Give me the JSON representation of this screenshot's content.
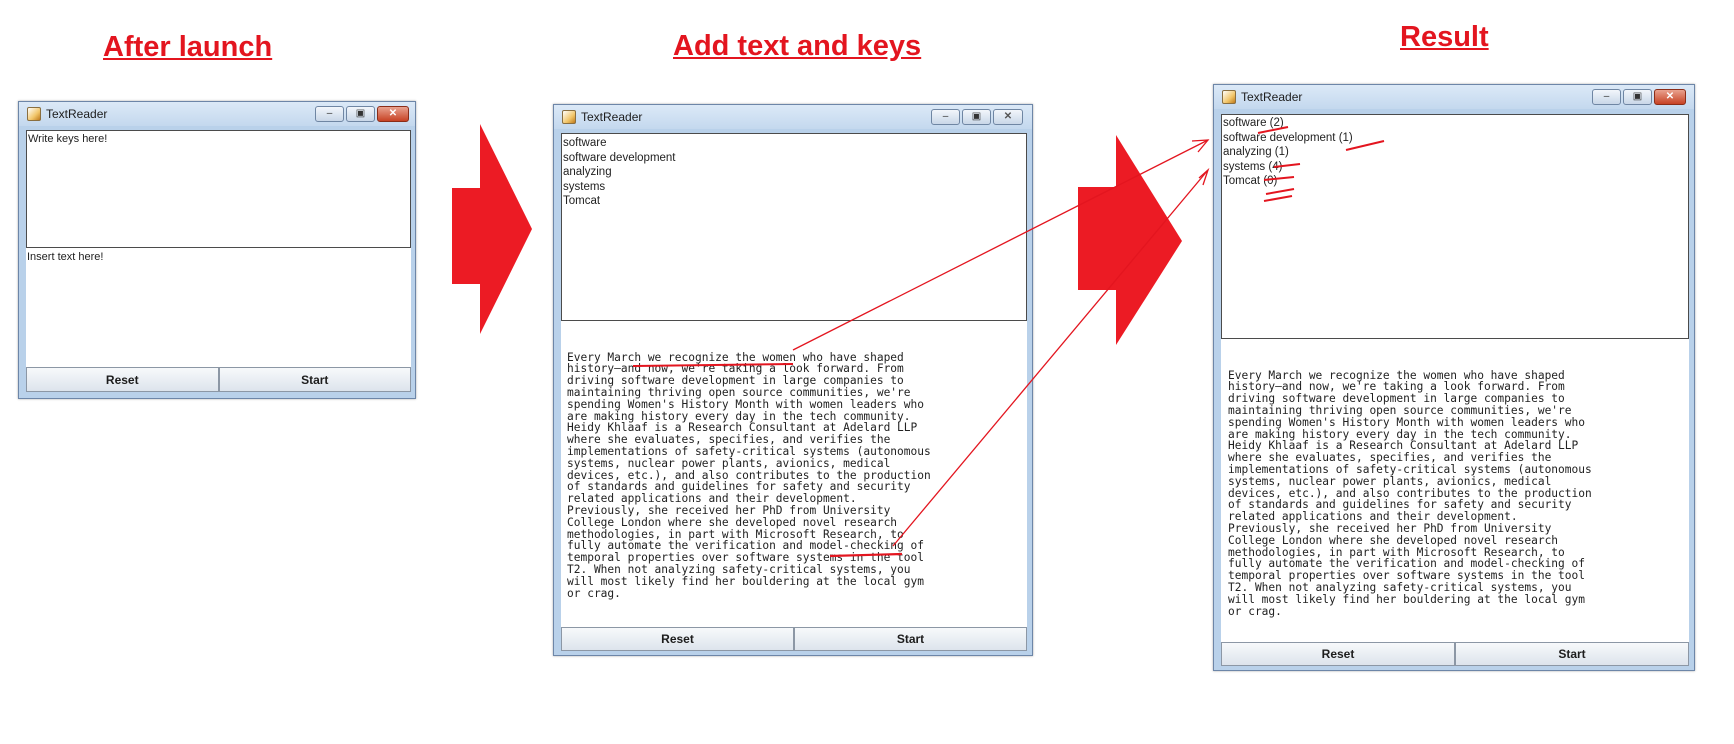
{
  "headings": {
    "step1": "After launch",
    "step2": "Add text and keys",
    "step3": "Result"
  },
  "window": {
    "title": "TextReader",
    "minimize_glyph": "‒",
    "maximize_glyph": "▣",
    "close_glyph": "✕"
  },
  "step1": {
    "keys_placeholder": "Write keys here!",
    "text_placeholder": "Insert text here!",
    "reset_label": "Reset",
    "start_label": "Start"
  },
  "step2": {
    "keys": [
      "software",
      "software development",
      "analyzing",
      "systems",
      "Tomcat"
    ],
    "text": "Every March we recognize the women who have shaped\nhistory—and now, we're taking a look forward. From\ndriving software development in large companies to\nmaintaining thriving open source communities, we're\nspending Women's History Month with women leaders who\nare making history every day in the tech community.\nHeidy Khlaaf is a Research Consultant at Adelard LLP\nwhere she evaluates, specifies, and verifies the\nimplementations of safety-critical systems (autonomous\nsystems, nuclear power plants, avionics, medical\ndevices, etc.), and also contributes to the production\nof standards and guidelines for safety and security\nrelated applications and their development.\nPreviously, she received her PhD from University\nCollege London where she developed novel research\nmethodologies, in part with Microsoft Research, to\nfully automate the verification and model-checking of\ntemporal properties over software systems in the tool\nT2. When not analyzing safety-critical systems, you\nwill most likely find her bouldering at the local gym\nor crag.",
    "reset_label": "Reset",
    "start_label": "Start"
  },
  "step3": {
    "keys": [
      "software (2)",
      "software development (1)",
      "analyzing (1)",
      "systems (4)",
      "Tomcat (0)"
    ],
    "text": "Every March we recognize the women who have shaped\nhistory—and now, we're taking a look forward. From\ndriving software development in large companies to\nmaintaining thriving open source communities, we're\nspending Women's History Month with women leaders who\nare making history every day in the tech community.\nHeidy Khlaaf is a Research Consultant at Adelard LLP\nwhere she evaluates, specifies, and verifies the\nimplementations of safety-critical systems (autonomous\nsystems, nuclear power plants, avionics, medical\ndevices, etc.), and also contributes to the production\nof standards and guidelines for safety and security\nrelated applications and their development.\nPreviously, she received her PhD from University\nCollege London where she developed novel research\nmethodologies, in part with Microsoft Research, to\nfully automate the verification and model-checking of\ntemporal properties over software systems in the tool\nT2. When not analyzing safety-critical systems, you\nwill most likely find her bouldering at the local gym\nor crag.",
    "reset_label": "Reset",
    "start_label": "Start"
  },
  "colors": {
    "annotation_red": "#e3151f",
    "window_frame": "#b9d1ea"
  }
}
